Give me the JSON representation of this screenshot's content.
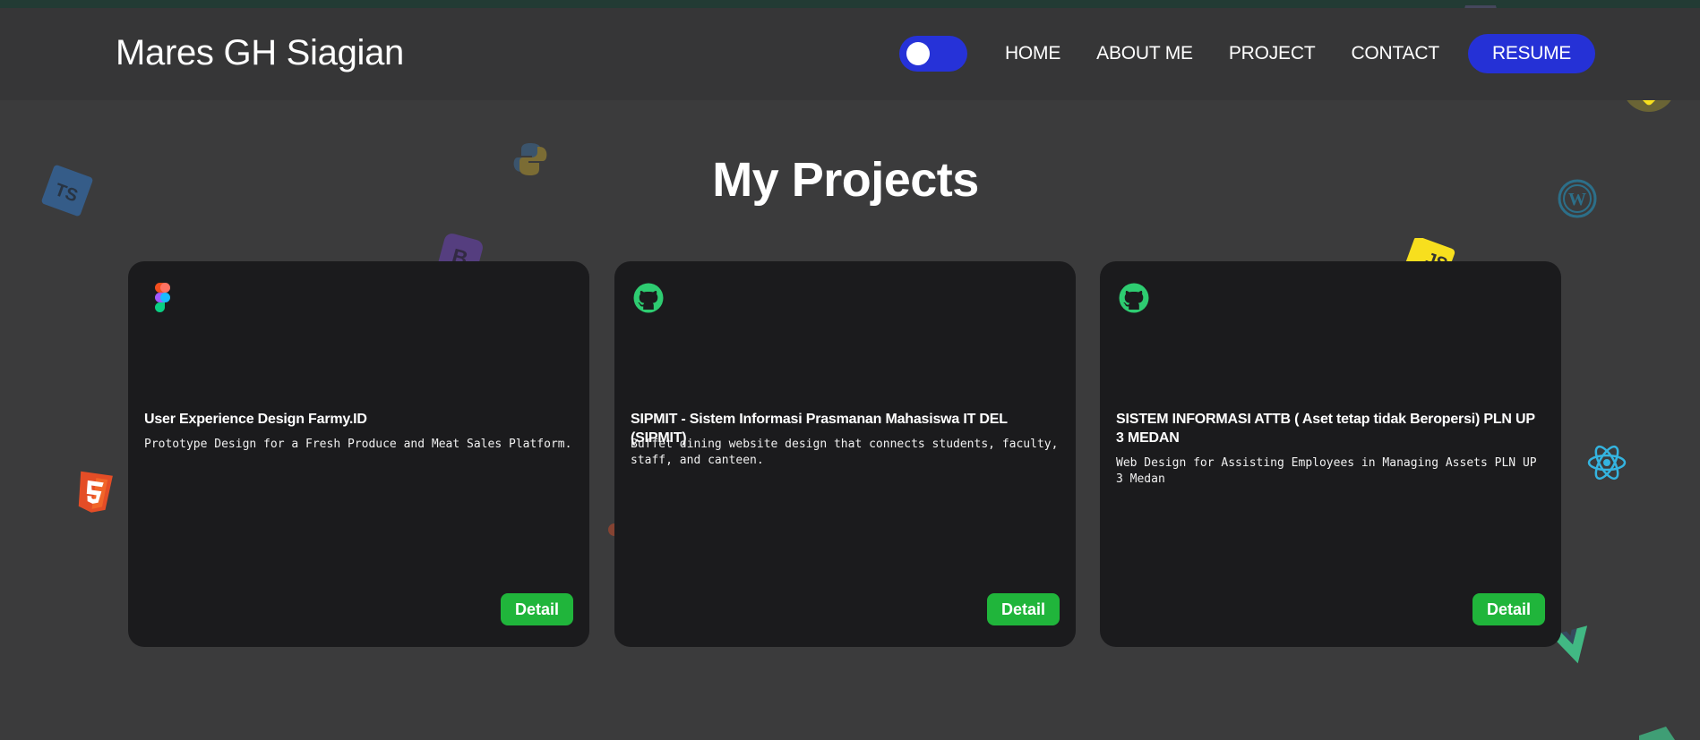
{
  "header": {
    "brand": "Mares GH Siagian",
    "nav": {
      "home": "HOME",
      "about": "ABOUT ME",
      "project": "PROJECT",
      "contact": "CONTACT",
      "resume": "RESUME"
    },
    "theme_toggle_on": true
  },
  "main": {
    "title": "My Projects",
    "projects": [
      {
        "icon": "figma-icon",
        "title": "User Experience Design Farmy.ID",
        "description": "Prototype Design for a Fresh Produce and Meat Sales Platform.",
        "button": "Detail"
      },
      {
        "icon": "github-icon",
        "title": "SIPMIT - Sistem Informasi Prasmanan Mahasiswa IT DEL (SIPMIT)",
        "description": "Buffet dining website design that connects students, faculty, staff, and canteen.",
        "button": "Detail"
      },
      {
        "icon": "github-icon",
        "title": "SISTEM INFORMASI ATTB ( Aset tetap tidak Beropersi) PLN UP 3 MEDAN",
        "description": "Web Design for Assisting Employees in Managing Assets PLN UP 3 Medan",
        "button": "Detail"
      }
    ]
  },
  "background_icons": [
    "typescript-icon",
    "python-icon",
    "bootstrap-icon",
    "html5-icon",
    "javascript-icon",
    "wordpress-icon",
    "react-icon",
    "vue-icon",
    "glow-orb-icon"
  ],
  "colors": {
    "accent_blue": "#2531d6",
    "detail_green": "#20b53b",
    "github_green": "#2ecc71",
    "card_bg": "#1b1b1d",
    "page_bg": "#3b3b3c"
  }
}
